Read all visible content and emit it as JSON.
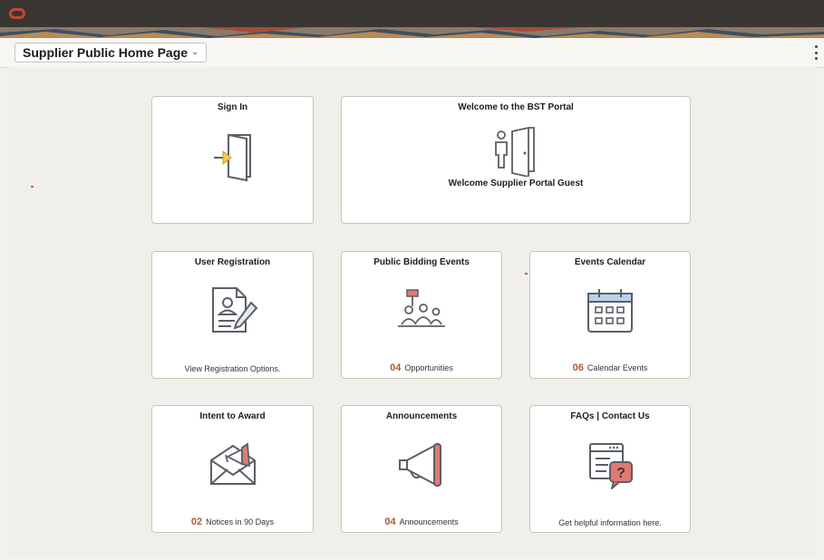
{
  "page": {
    "title": "Supplier Public Home Page",
    "title_chevron": "⌄"
  },
  "tiles": {
    "sign_in": {
      "title": "Sign In"
    },
    "welcome": {
      "title": "Welcome to the BST Portal",
      "subtitle": "Welcome Supplier Portal Guest"
    },
    "user_registration": {
      "title": "User Registration",
      "footer": "View Registration Options."
    },
    "public_bidding": {
      "title": "Public Bidding Events",
      "count": "04",
      "footer": "Opportunities"
    },
    "events_calendar": {
      "title": "Events Calendar",
      "count": "06",
      "footer": "Calendar Events"
    },
    "intent_to_award": {
      "title": "Intent to Award",
      "count": "02",
      "footer": "Notices in 90 Days"
    },
    "announcements": {
      "title": "Announcements",
      "count": "04",
      "footer": "Announcements"
    },
    "faqs": {
      "title": "FAQs | Contact Us",
      "footer": "Get helpful information here."
    }
  },
  "colors": {
    "accent": "#c74634",
    "count": "#b0573a",
    "topbar": "#3a3633",
    "icon_stroke": "#5a5f66",
    "icon_accent": "#e07a73"
  },
  "icons": [
    "oracle-logo",
    "sign-in-door-icon",
    "welcome-person-door-icon",
    "registration-form-icon",
    "bidding-people-icon",
    "calendar-icon",
    "award-envelope-icon",
    "megaphone-icon",
    "faq-help-icon",
    "kebab-menu-icon"
  ]
}
